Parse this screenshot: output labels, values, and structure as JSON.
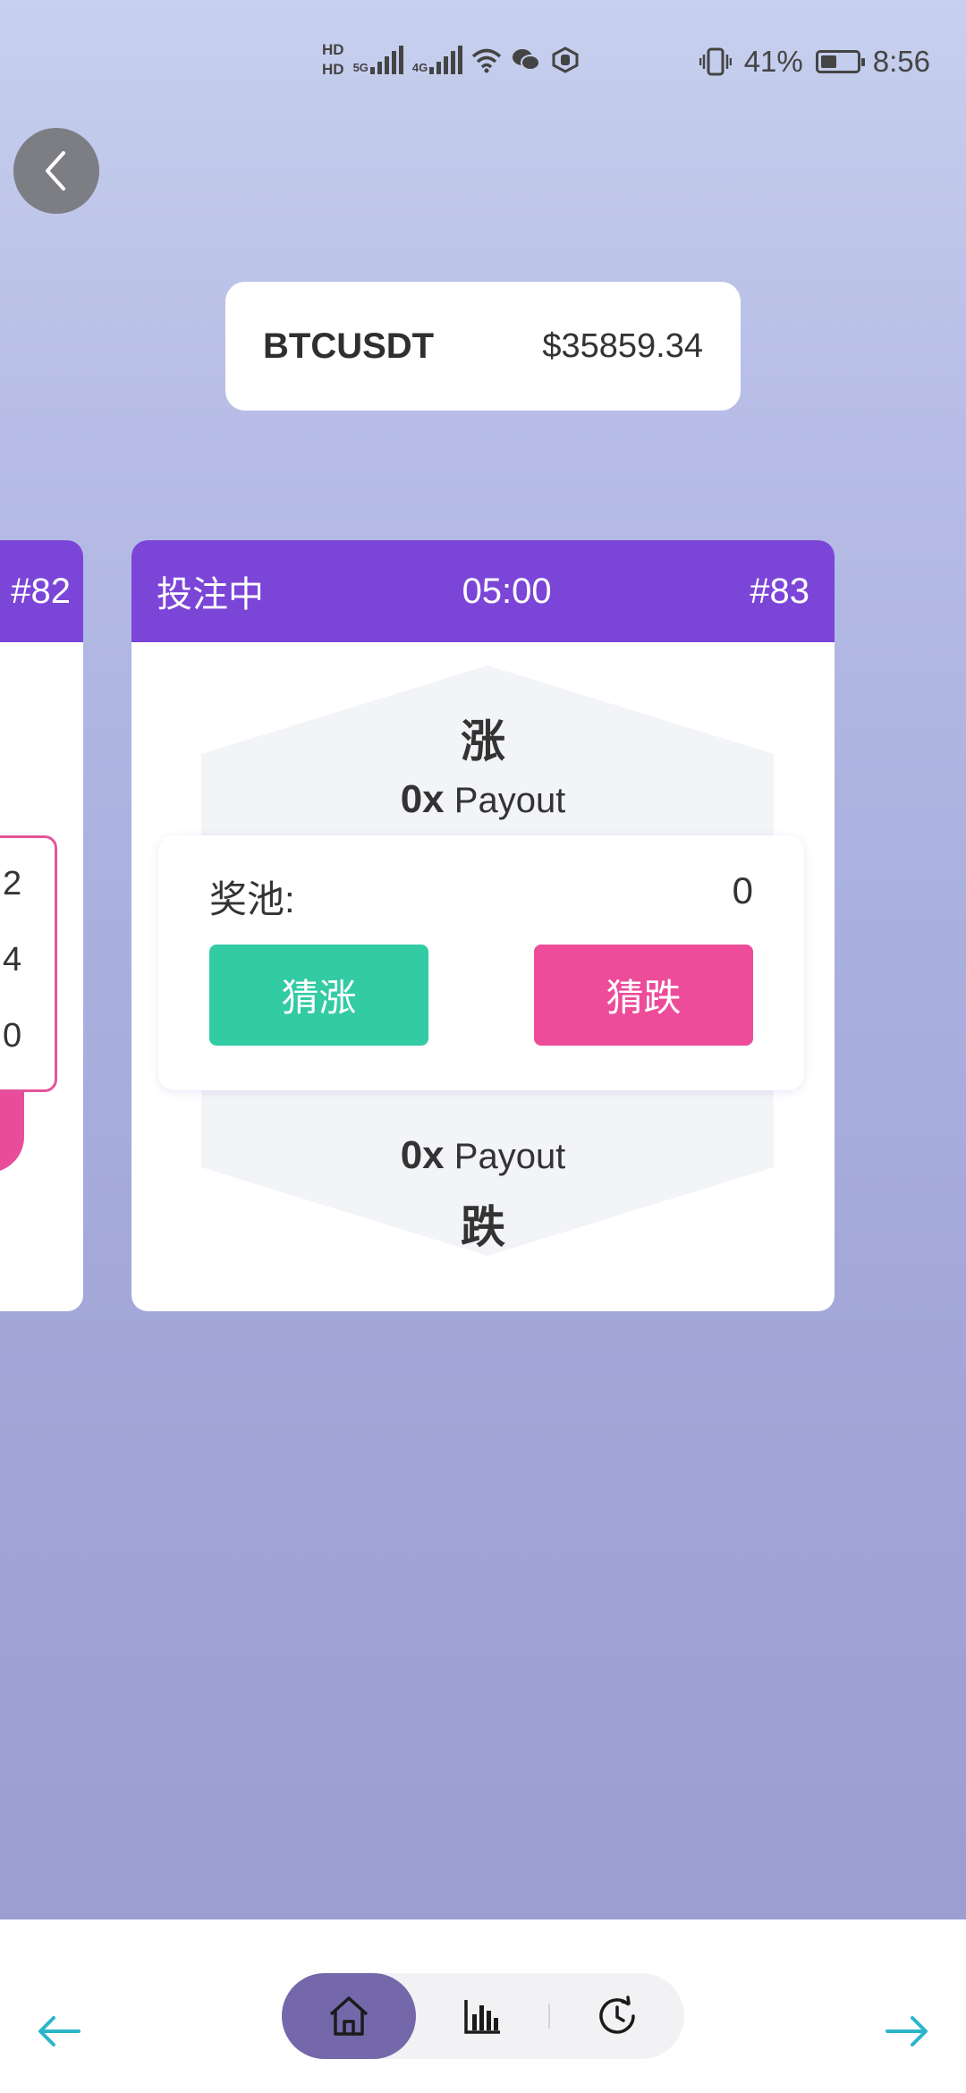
{
  "status_bar": {
    "hd1": "HD",
    "hd2": "HD",
    "net1": "5G",
    "net2": "4G",
    "battery": "41%",
    "time": "8:56"
  },
  "ticker": {
    "symbol": "BTCUSDT",
    "price": "$35859.34"
  },
  "prev_card": {
    "round": "#82",
    "digits": [
      "2",
      "4",
      "0"
    ]
  },
  "card": {
    "status": "投注中",
    "timer": "05:00",
    "round": "#83",
    "up_label": "涨",
    "down_label": "跌",
    "up_multiplier": "0x",
    "down_multiplier": "0x",
    "payout_text": "Payout",
    "pool_label": "奖池:",
    "pool_value": "0",
    "btn_up": "猜涨",
    "btn_down": "猜跌"
  },
  "colors": {
    "header": "#7b45d8",
    "up": "#33cba3",
    "down": "#ec4c9a",
    "nav_active": "#7468ab",
    "arrow": "#2bb5c9"
  },
  "nav": {
    "items": [
      "home-icon",
      "chart-icon",
      "history-icon"
    ],
    "active": "home-icon"
  }
}
